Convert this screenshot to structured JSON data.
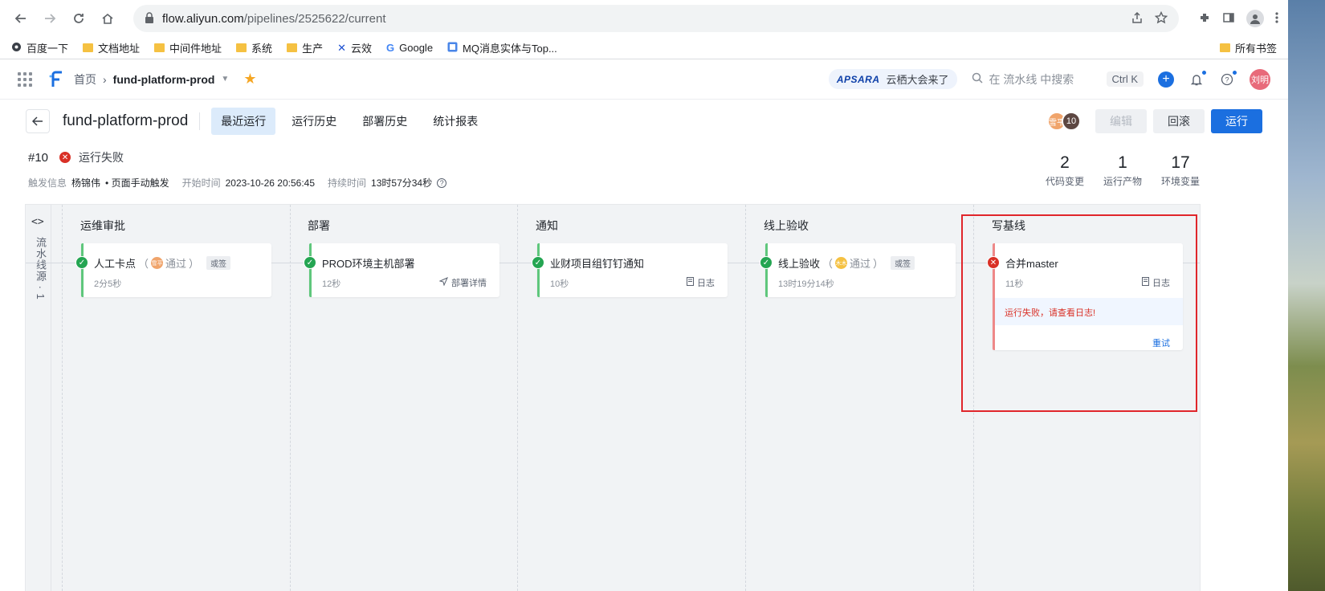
{
  "browser": {
    "url_host": "flow.aliyun.com",
    "url_path": "/pipelines/2525622/current",
    "bookmarks": [
      {
        "label": "百度一下",
        "icon": "globe-icon"
      },
      {
        "label": "文档地址",
        "icon": "folder-icon"
      },
      {
        "label": "中间件地址",
        "icon": "folder-icon"
      },
      {
        "label": "系统",
        "icon": "folder-icon"
      },
      {
        "label": "生产",
        "icon": "folder-icon"
      },
      {
        "label": "云效",
        "icon": "yunxiao-icon"
      },
      {
        "label": "Google",
        "icon": "google-icon"
      },
      {
        "label": "MQ消息实体与Top...",
        "icon": "page-icon"
      }
    ],
    "bookmarks_right": "所有书签"
  },
  "app": {
    "breadcrumb_home": "首页",
    "project": "fund-platform-prod",
    "apsara_logo": "APSARA",
    "apsara_text": "云栖大会来了",
    "search_placeholder": "在 流水线 中搜索",
    "shortcut": "Ctrl K",
    "user_initials": "刘明"
  },
  "page": {
    "pipeline_name": "fund-platform-prod",
    "tabs": [
      "最近运行",
      "运行历史",
      "部署历史",
      "统计报表"
    ],
    "active_tab": 0,
    "avatar1": "雪平",
    "avatar2": "10",
    "edit_label": "编辑",
    "rollback_label": "回滚",
    "run_label": "运行"
  },
  "run": {
    "id": "#10",
    "status": "运行失败",
    "trigger_label": "触发信息",
    "trigger_user": "杨锦伟",
    "trigger_mode": "• 页面手动触发",
    "start_label": "开始时间",
    "start_time": "2023-10-26 20:56:45",
    "duration_label": "持续时间",
    "duration": "13时57分34秒"
  },
  "stats": [
    {
      "value": "2",
      "label": "代码变更"
    },
    {
      "value": "1",
      "label": "运行产物"
    },
    {
      "value": "17",
      "label": "环境变量"
    }
  ],
  "canvas": {
    "side_label": "流水线源 · 1",
    "stages": [
      {
        "title": "运维审批",
        "job": {
          "name": "人工卡点",
          "approver": "雪平",
          "result": "通过",
          "tag": "或签",
          "duration": "2分5秒",
          "status": "ok"
        }
      },
      {
        "title": "部署",
        "job": {
          "name": "PROD环境主机部署",
          "duration": "12秒",
          "link": "部署详情",
          "status": "ok"
        }
      },
      {
        "title": "通知",
        "job": {
          "name": "业财项目组钉钉通知",
          "duration": "10秒",
          "link": "日志",
          "status": "ok"
        }
      },
      {
        "title": "线上验收",
        "job": {
          "name": "线上验收",
          "approver": "木木",
          "result": "通过",
          "tag": "或签",
          "duration": "13时19分14秒",
          "status": "ok"
        }
      },
      {
        "title": "写基线",
        "job": {
          "name": "合并master",
          "duration": "11秒",
          "link": "日志",
          "status": "bad",
          "error": "运行失败，请查看日志!",
          "retry": "重试"
        }
      }
    ]
  },
  "colors": {
    "primary": "#1b6fe0",
    "success": "#24a552",
    "danger": "#d93026",
    "highlight": "#e0262b"
  }
}
